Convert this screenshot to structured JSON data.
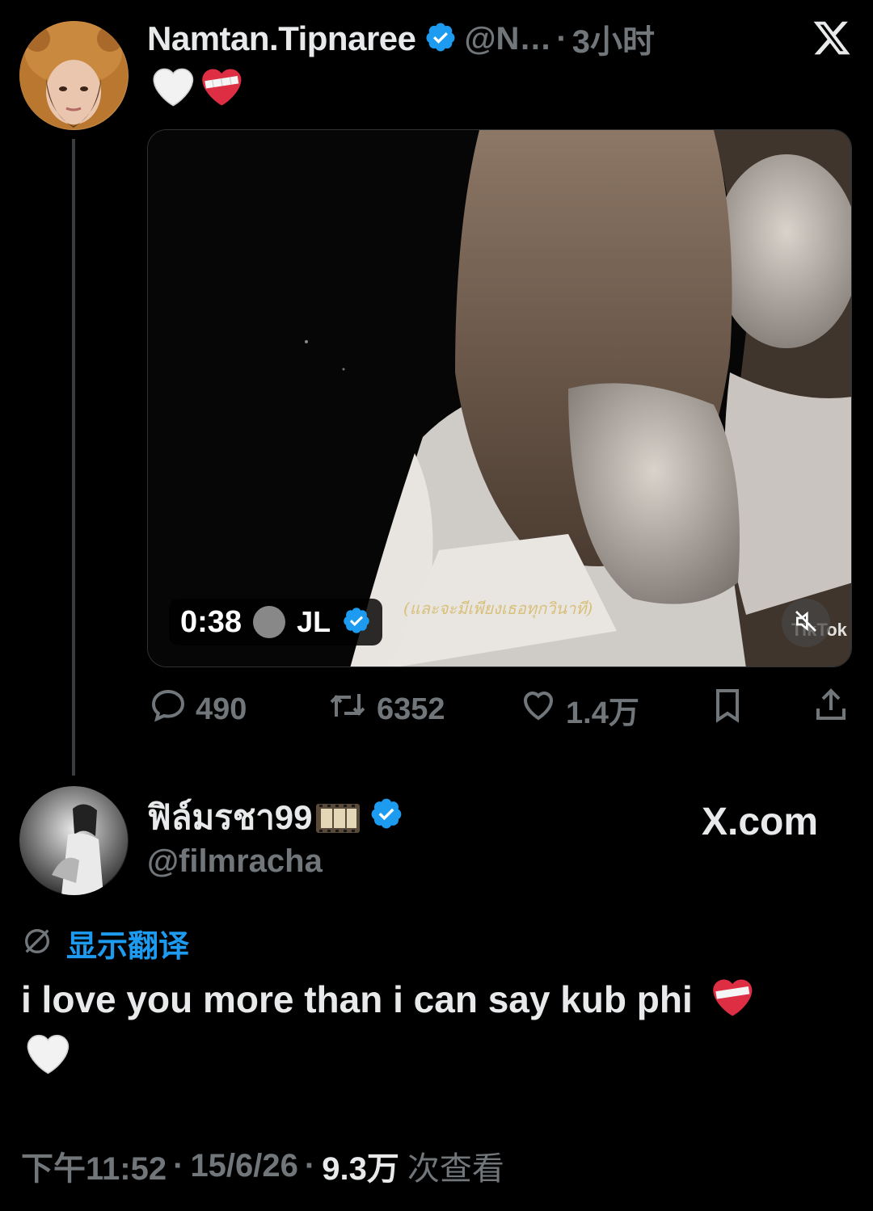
{
  "first_tweet": {
    "display_name": "Namtan.Tipnaree",
    "handle": "@N…",
    "separator": "·",
    "time": "3小时",
    "media": {
      "duration": "0:38",
      "uploader": "JL",
      "subtitle": "(และจะมีเพียงเธอทุกวินาที)",
      "watermark": "TikTok"
    },
    "actions": {
      "replies": "490",
      "reposts": "6352",
      "likes": "1.4万"
    }
  },
  "second_tweet": {
    "display_name": "ฟิล์มรชา99",
    "handle": "@filmracha",
    "site_label": "X.com",
    "translate_label": "显示翻译",
    "text": "i love you more than i can say kub phi",
    "timestamp": {
      "time": "下午11:52",
      "date": "15/6/26",
      "views_count": "9.3万",
      "views_label": "次查看",
      "separator": "·"
    }
  },
  "colors": {
    "background": "#000000",
    "primary_text": "#e7e9ea",
    "secondary_text": "#71767b",
    "accent_blue": "#1d9bf0",
    "heart_red": "#e0245e"
  },
  "icons": [
    "avatar",
    "verified-badge-icon",
    "x-logo-icon",
    "white-heart-icon",
    "mending-heart-icon",
    "reply-icon",
    "repost-icon",
    "like-icon",
    "bookmark-icon",
    "share-icon",
    "mute-icon",
    "film-strip-icon",
    "translate-icon"
  ]
}
